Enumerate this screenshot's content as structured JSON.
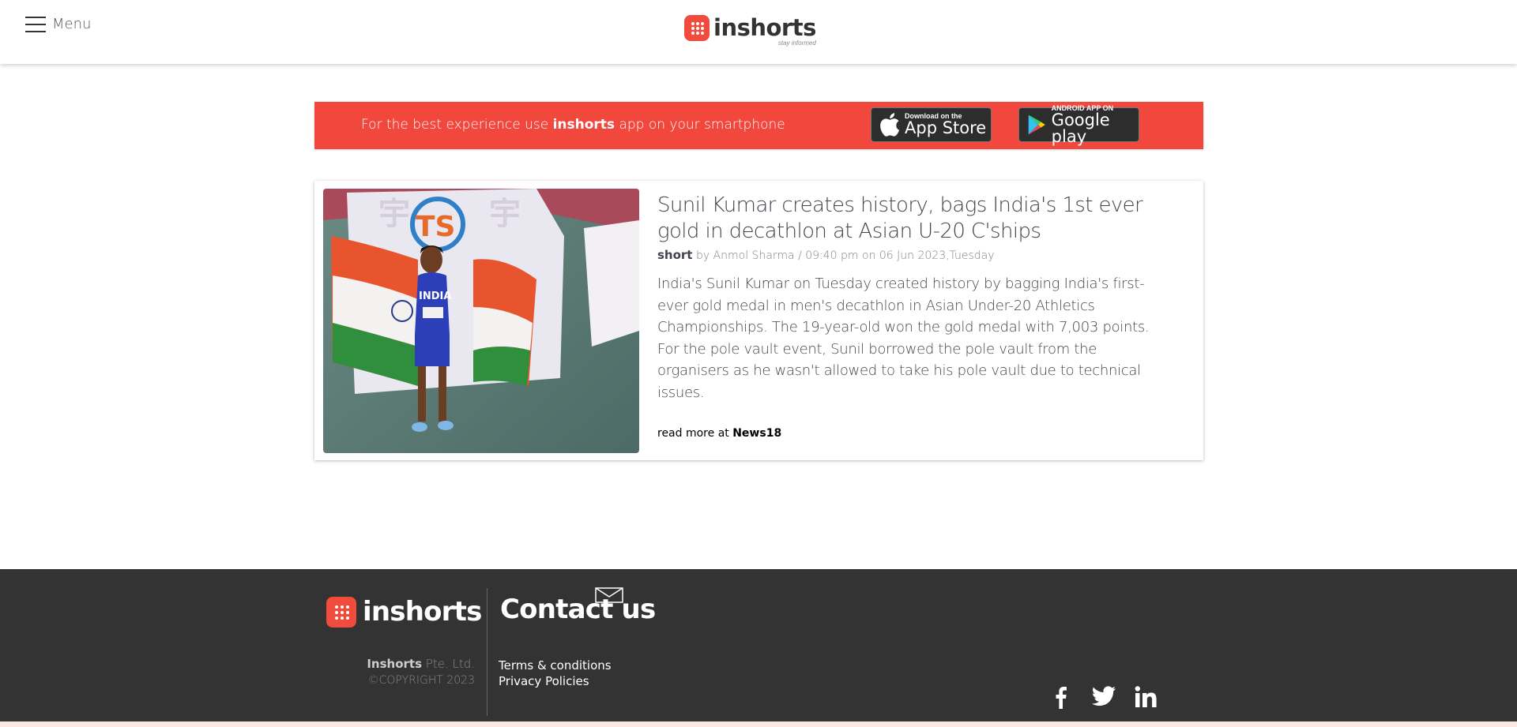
{
  "header": {
    "menu_label": "Menu",
    "logo_text": "inshorts",
    "logo_tagline": "stay informed"
  },
  "banner": {
    "text_before": "For the best experience use ",
    "text_brand": "inshorts",
    "text_after": " app on your smartphone",
    "app_store_small": "Download on the",
    "app_store_big": "App Store",
    "google_small": "ANDROID APP ON",
    "google_big": "Google play"
  },
  "article": {
    "headline": "Sunil Kumar creates history, bags India's 1st ever gold in decathlon at Asian U-20 C'ships",
    "tag": "short",
    "byline": "by Anmol Sharma / 09:40 pm on 06 Jun 2023,Tuesday",
    "body": "India's Sunil Kumar on Tuesday created history by bagging India's first-ever gold medal in men's decathlon in Asian Under-20 Athletics Championships. The 19-year-old won the gold medal with 7,003 points. For the pole vault event, Sunil borrowed the pole vault from the organisers as he wasn't allowed to take his pole vault due to technical issues.",
    "read_more_prefix": "read more at ",
    "source": "News18",
    "image_logo_text": "TS",
    "image_bib_text": "INDIA"
  },
  "footer": {
    "logo_text": "inshorts",
    "contact_title": "Contact us",
    "company_name": "Inshorts",
    "company_suffix": " Pte. Ltd.",
    "copyright": "©COPYRIGHT 2023",
    "terms": "Terms & conditions",
    "privacy": "Privacy Policies"
  },
  "colors": {
    "brand_red": "#f2473d",
    "footer_bg": "#333333"
  },
  "icons": [
    "hamburger-icon",
    "apple-icon",
    "google-play-icon",
    "envelope-icon",
    "facebook-icon",
    "twitter-icon",
    "linkedin-icon"
  ]
}
